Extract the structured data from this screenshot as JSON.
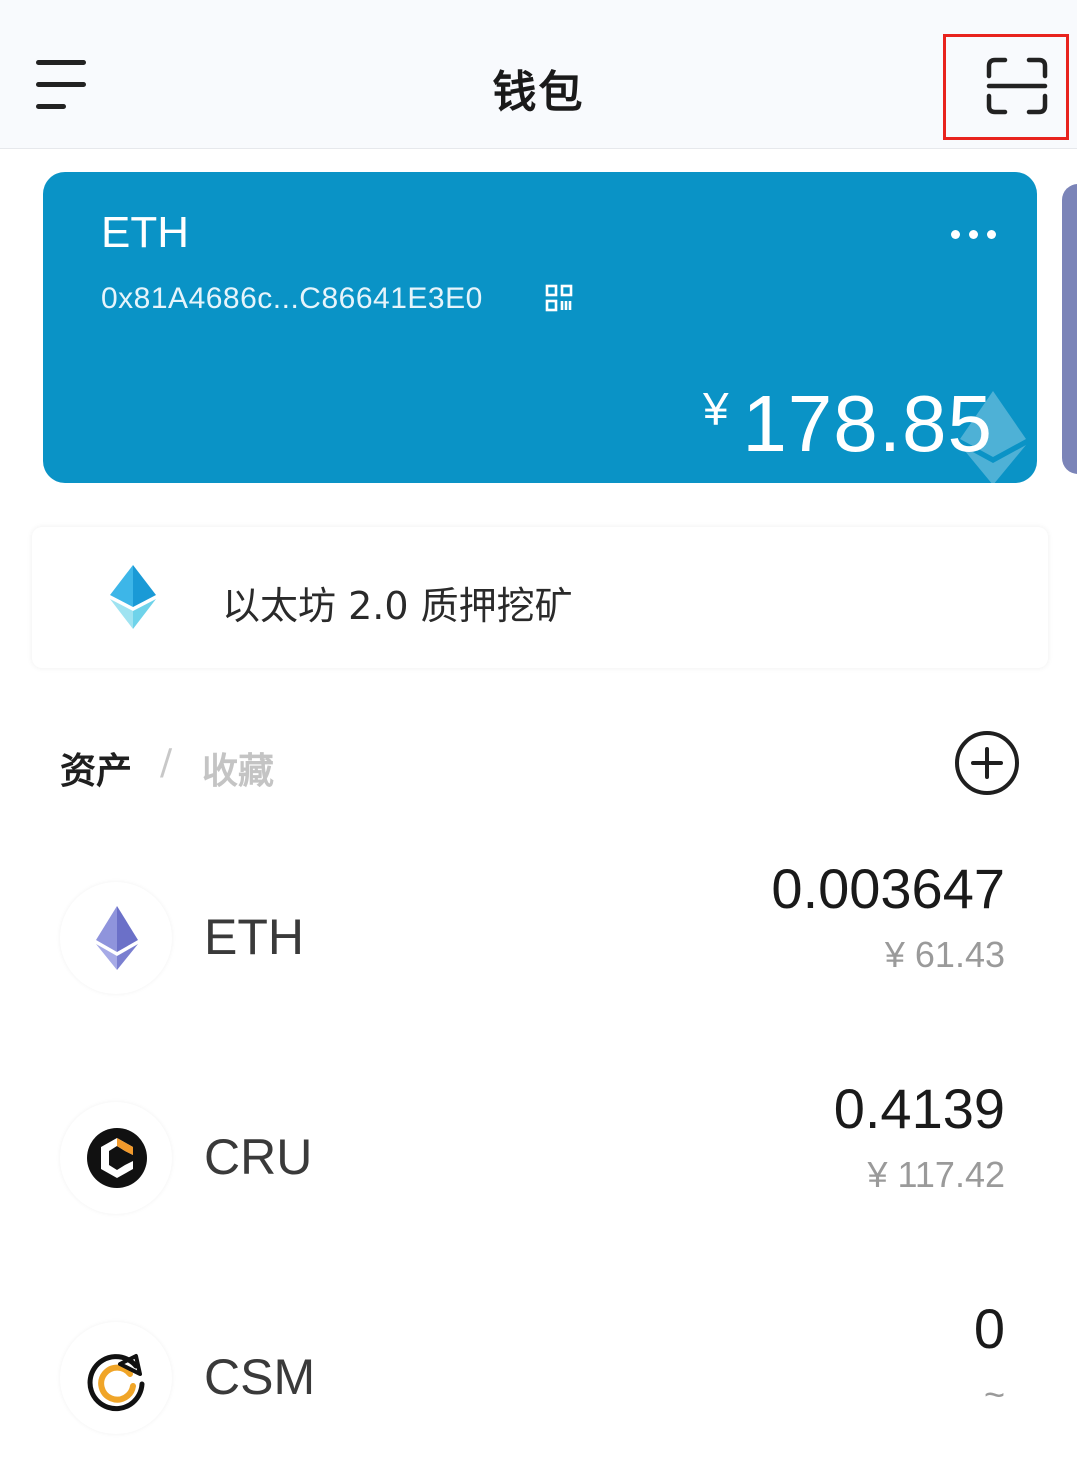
{
  "header": {
    "title": "钱包",
    "menu_icon": "menu-icon",
    "scan_icon": "scan-icon",
    "highlight_color": "#e8231e"
  },
  "wallet_card": {
    "chain": "ETH",
    "address": "0x81A4686c...C86641E3E0",
    "currency_symbol": "¥",
    "balance": "178.85",
    "background_color": "#0a93c6",
    "more_icon": "more-horizontal-icon",
    "qr_icon": "qr-code-icon"
  },
  "staking_banner": {
    "label": "以太坊 2.0 质押挖矿",
    "icon": "eth2-diamond-icon"
  },
  "asset_tabs": {
    "assets": "资产",
    "separator": "/",
    "favorites": "收藏",
    "add_icon": "add-circle-icon"
  },
  "assets": [
    {
      "symbol": "ETH",
      "amount": "0.003647",
      "value": "¥ 61.43",
      "icon": "eth-logo-icon"
    },
    {
      "symbol": "CRU",
      "amount": "0.4139",
      "value": "¥ 117.42",
      "icon": "cru-logo-icon"
    },
    {
      "symbol": "CSM",
      "amount": "0",
      "value": "~",
      "icon": "csm-logo-icon"
    }
  ]
}
